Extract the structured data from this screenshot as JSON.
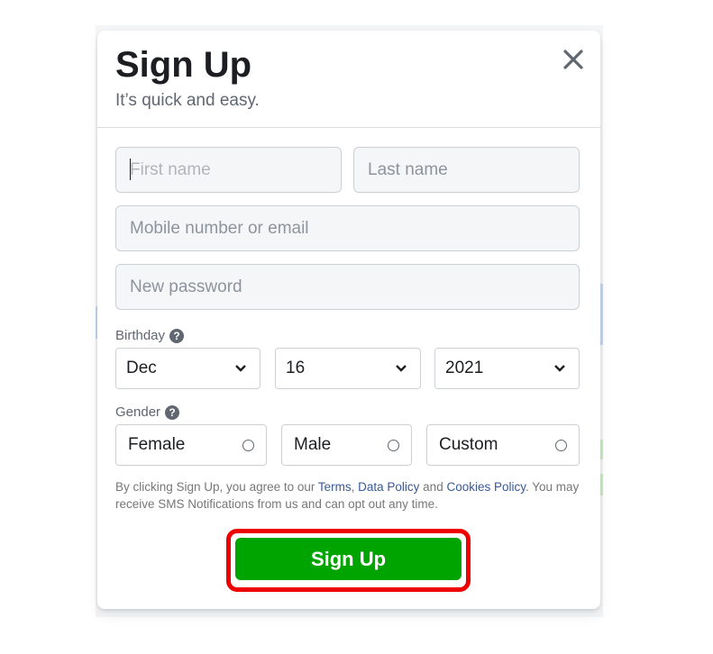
{
  "modal": {
    "title": "Sign Up",
    "subtitle": "It’s quick and easy.",
    "close_icon": "close-icon"
  },
  "form": {
    "first_name": {
      "value": "",
      "placeholder": "First name"
    },
    "last_name": {
      "value": "",
      "placeholder": "Last name"
    },
    "contact": {
      "value": "",
      "placeholder": "Mobile number or email"
    },
    "password": {
      "value": "",
      "placeholder": "New password"
    },
    "birthday": {
      "label": "Birthday",
      "help_icon": "question-circle-icon",
      "month": "Dec",
      "day": "16",
      "year": "2021"
    },
    "gender": {
      "label": "Gender",
      "help_icon": "question-circle-icon",
      "options": [
        {
          "label": "Female",
          "selected": false
        },
        {
          "label": "Male",
          "selected": false
        },
        {
          "label": "Custom",
          "selected": false
        }
      ]
    },
    "terms": {
      "prefix": "By clicking Sign Up, you agree to our ",
      "terms_link": "Terms",
      "sep1": ", ",
      "data_policy_link": "Data Policy",
      "sep2": " and ",
      "cookies_link": "Cookies Policy",
      "suffix": ". You may receive SMS Notifications from us and can opt out any time."
    },
    "submit_label": "Sign Up"
  },
  "colors": {
    "accent": "#00a400",
    "link": "#385898",
    "highlight": "#ee0000"
  }
}
